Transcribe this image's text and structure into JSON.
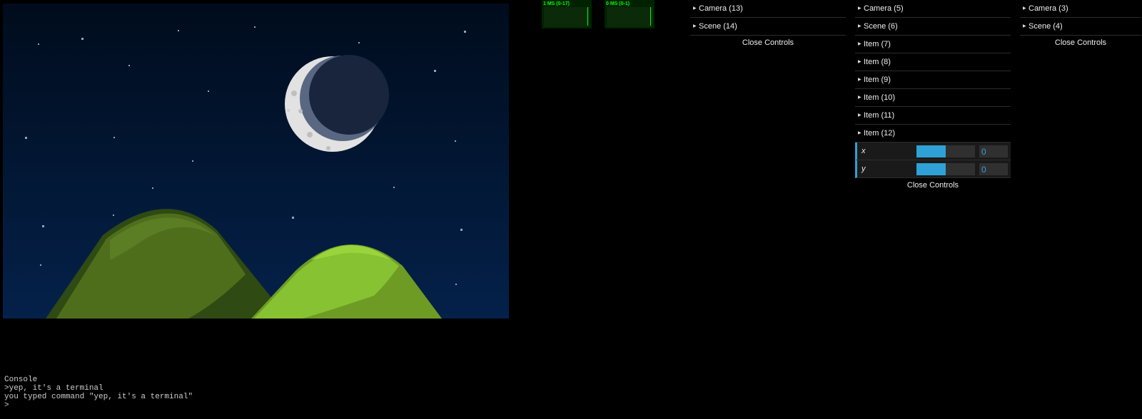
{
  "stats": [
    {
      "label": "1 MS (0-17)",
      "level": 0.93
    },
    {
      "label": "0 MS (0-1)",
      "level": 0.93
    }
  ],
  "gui_panels": [
    {
      "folders": [
        "Camera (13)",
        "Scene (14)"
      ],
      "controls": [],
      "close_label": "Close Controls"
    },
    {
      "folders": [
        "Camera (5)",
        "Scene (6)",
        "Item (7)",
        "Item (8)",
        "Item (9)",
        "Item (10)",
        "Item (11)",
        "Item (12)"
      ],
      "controls": [
        {
          "name": "x",
          "value": "0",
          "fill": 0.5
        },
        {
          "name": "y",
          "value": "0",
          "fill": 0.5
        }
      ],
      "close_label": "Close Controls"
    },
    {
      "folders": [
        "Camera (3)",
        "Scene (4)"
      ],
      "controls": [],
      "close_label": "Close Controls"
    }
  ],
  "console": {
    "title": "Console",
    "lines": [
      ">yep, it's a terminal",
      "you typed command \"yep, it's a terminal\"",
      ">"
    ]
  },
  "colors": {
    "accent": "#2fa1d6",
    "stats_text": "#00ff00",
    "sky_top": "#000c1c",
    "sky_bottom": "#04214a",
    "hill_dark": "#4e6e1c",
    "hill_light": "#86c232"
  }
}
